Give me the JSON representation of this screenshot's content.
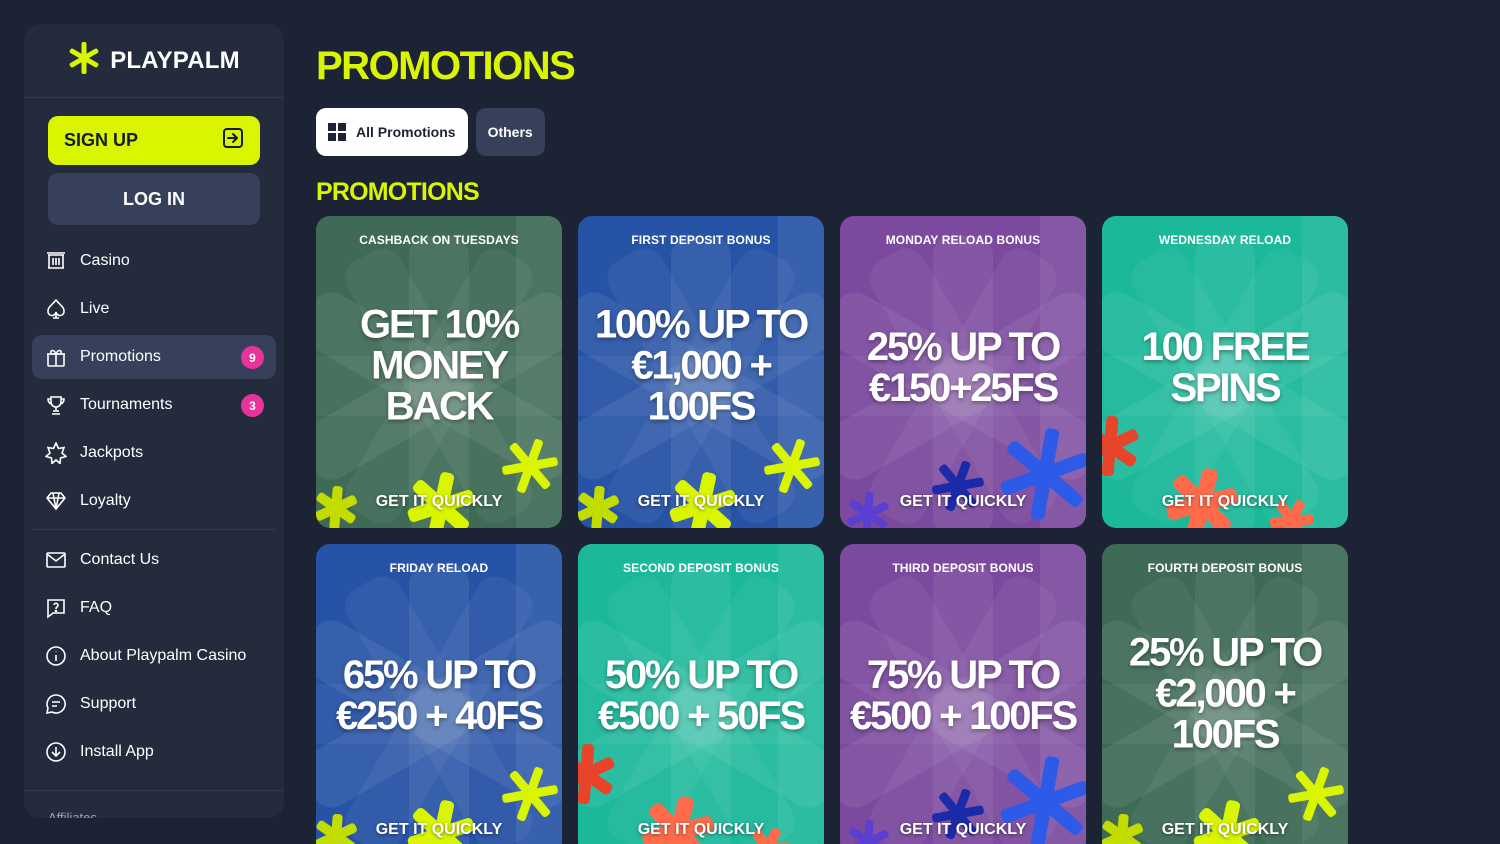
{
  "brand": {
    "name": "PLAYPALM",
    "accent": "#d9f500"
  },
  "auth": {
    "signup_label": "SIGN UP",
    "login_label": "LOG IN"
  },
  "nav": {
    "items": [
      {
        "label": "Casino",
        "icon": "casino-icon"
      },
      {
        "label": "Live",
        "icon": "spade-icon"
      },
      {
        "label": "Promotions",
        "icon": "gift-icon",
        "badge": "9",
        "active": true
      },
      {
        "label": "Tournaments",
        "icon": "trophy-icon",
        "badge": "3"
      },
      {
        "label": "Jackpots",
        "icon": "star-icon"
      },
      {
        "label": "Loyalty",
        "icon": "diamond-icon"
      }
    ],
    "secondary": [
      {
        "label": "Contact Us",
        "icon": "mail-icon"
      },
      {
        "label": "FAQ",
        "icon": "question-icon"
      },
      {
        "label": "About Playpalm Casino",
        "icon": "info-icon"
      },
      {
        "label": "Support",
        "icon": "chat-icon"
      },
      {
        "label": "Install App",
        "icon": "download-icon"
      }
    ],
    "footer_label": "Affiliates"
  },
  "page": {
    "title": "PROMOTIONS",
    "section_title": "PROMOTIONS"
  },
  "tabs": [
    {
      "label": "All Promotions",
      "active": true
    },
    {
      "label": "Others",
      "active": false
    }
  ],
  "cards": [
    {
      "label": "CASHBACK ON TUESDAYS",
      "headline": "GET 10% MONEY BACK",
      "cta": "GET IT QUICKLY",
      "theme": "green",
      "color": "#3f6b56"
    },
    {
      "label": "FIRST DEPOSIT BONUS",
      "headline": "100% UP TO €1,000 + 100FS",
      "cta": "GET IT QUICKLY",
      "theme": "blue",
      "color": "#2753a6"
    },
    {
      "label": "MONDAY RELOAD BONUS",
      "headline": "25% UP TO €150+25FS",
      "cta": "GET IT QUICKLY",
      "theme": "purple",
      "color": "#7b4a9e"
    },
    {
      "label": "WEDNESDAY RELOAD",
      "headline": "100 FREE SPINS",
      "cta": "GET IT QUICKLY",
      "theme": "teal",
      "color": "#1bb89a"
    },
    {
      "label": "FRIDAY RELOAD",
      "headline": "65% UP TO €250 + 40FS",
      "cta": "GET IT QUICKLY",
      "theme": "blue",
      "color": "#2753a6"
    },
    {
      "label": "SECOND DEPOSIT BONUS",
      "headline": "50% UP TO €500 + 50FS",
      "cta": "GET IT QUICKLY",
      "theme": "teal",
      "color": "#1bb89a"
    },
    {
      "label": "THIRD DEPOSIT BONUS",
      "headline": "75% UP TO €500 + 100FS",
      "cta": "GET IT QUICKLY",
      "theme": "purple",
      "color": "#7b4a9e"
    },
    {
      "label": "FOURTH DEPOSIT BONUS",
      "headline": "25% UP TO €2,000 + 100FS",
      "cta": "GET IT QUICKLY",
      "theme": "green",
      "color": "#3f6b56"
    }
  ]
}
